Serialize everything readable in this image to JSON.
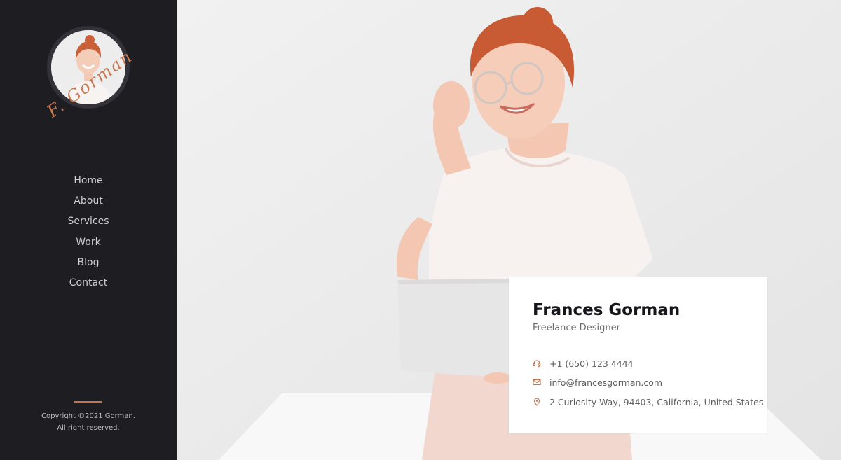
{
  "sidebar": {
    "signature_text": "F. Gorman",
    "nav": [
      {
        "label": "Home"
      },
      {
        "label": "About"
      },
      {
        "label": "Services"
      },
      {
        "label": "Work"
      },
      {
        "label": "Blog"
      },
      {
        "label": "Contact"
      }
    ],
    "copyright_line1": "Copyright ©2021 Gorman.",
    "copyright_line2": "All right reserved."
  },
  "profile": {
    "name": "Frances Gorman",
    "title": "Freelance Designer",
    "phone": "+1 (650) 123 4444",
    "email": "info@francesgorman.com",
    "address": "2 Curiosity Way, 94403, California, United States"
  },
  "icons": {
    "phone": "headset-icon",
    "email": "envelope-icon",
    "address": "map-pin-icon"
  },
  "colors": {
    "sidebar_bg": "#1e1d21",
    "accent": "#c5744e",
    "hero_bg": "#ececec",
    "card_bg": "#ffffff"
  }
}
